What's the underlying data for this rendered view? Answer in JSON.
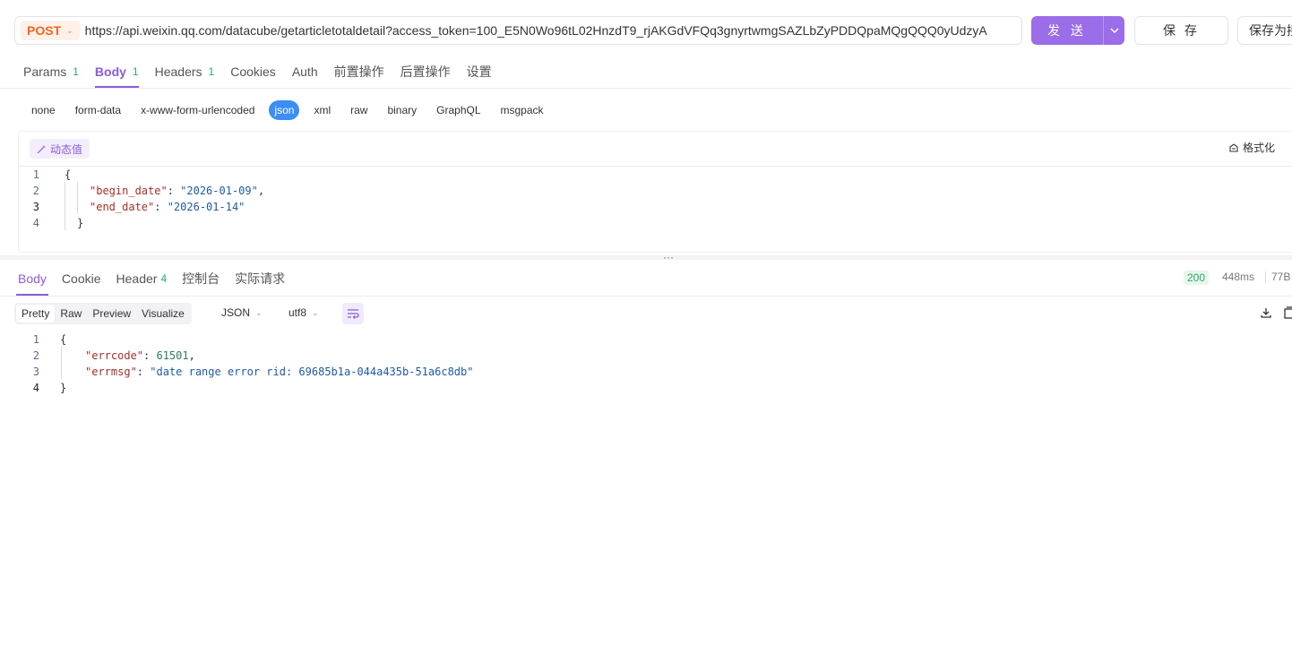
{
  "request": {
    "method": "POST",
    "url": "https://api.weixin.qq.com/datacube/getarticletotaldetail?access_token=100_E5N0Wo96tL02HnzdT9_rjAKGdVFQq3gnyrtwmgSAZLbZyPDDQpaMQgQQQ0yUdzyA",
    "send_label": "发 送",
    "save_label": "保 存",
    "save_as_label": "保存为接口"
  },
  "request_tabs": [
    {
      "label": "Params",
      "count": "1"
    },
    {
      "label": "Body",
      "count": "1"
    },
    {
      "label": "Headers",
      "count": "1"
    },
    {
      "label": "Cookies",
      "count": ""
    },
    {
      "label": "Auth",
      "count": ""
    },
    {
      "label": "前置操作",
      "count": ""
    },
    {
      "label": "后置操作",
      "count": ""
    },
    {
      "label": "设置",
      "count": ""
    }
  ],
  "active_request_tab": "Body",
  "body_types": [
    "none",
    "form-data",
    "x-www-form-urlencoded",
    "json",
    "xml",
    "raw",
    "binary",
    "GraphQL",
    "msgpack"
  ],
  "active_body_type": "json",
  "editor": {
    "dynamic_value_label": "动态值",
    "format_label": "格式化",
    "lines": [
      {
        "no": "1",
        "key": "",
        "value": "",
        "text": "{"
      },
      {
        "no": "2",
        "key": "\"begin_date\"",
        "value": "\"2026-01-09\"",
        "suffix": ","
      },
      {
        "no": "3",
        "key": "\"end_date\"",
        "value": "\"2026-01-14\"",
        "suffix": ""
      },
      {
        "no": "4",
        "key": "",
        "value": "",
        "text": "}"
      }
    ]
  },
  "response_tabs": [
    {
      "label": "Body",
      "count": ""
    },
    {
      "label": "Cookie",
      "count": ""
    },
    {
      "label": "Header",
      "count": "4"
    },
    {
      "label": "控制台",
      "count": ""
    },
    {
      "label": "实际请求",
      "count": ""
    }
  ],
  "active_response_tab": "Body",
  "response_meta": {
    "status": "200",
    "time": "448ms",
    "size": "77B"
  },
  "view_modes": [
    "Pretty",
    "Raw",
    "Preview",
    "Visualize"
  ],
  "active_view_mode": "Pretty",
  "format_select": "JSON",
  "encoding_select": "utf8",
  "response_body": {
    "lines": [
      {
        "no": "1",
        "text": "{"
      },
      {
        "no": "2",
        "key": "\"errcode\"",
        "value": "61501",
        "suffix": ","
      },
      {
        "no": "3",
        "key": "\"errmsg\"",
        "value": "\"date range error rid: 69685b1a-044a435b-51a6c8db\"",
        "suffix": ""
      },
      {
        "no": "4",
        "text": "}"
      }
    ]
  },
  "colors": {
    "accent": "#8b5cd6",
    "send_button": "#9b6de8",
    "method_text": "#f26522",
    "json_pill": "#3b8ef5",
    "status_ok": "#2da864"
  }
}
